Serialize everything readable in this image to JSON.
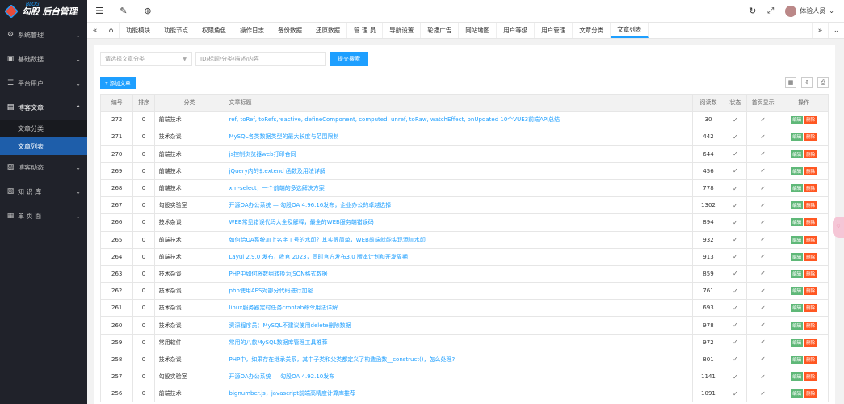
{
  "logo": {
    "brand": "勾股",
    "subtitle": "后台管理",
    "blog": "BLOG"
  },
  "sidebar": {
    "items": [
      {
        "label": "系统管理",
        "icon": "gear-icon",
        "glyph": "⚙",
        "arrow": "⌄"
      },
      {
        "label": "基础数据",
        "icon": "cube-icon",
        "glyph": "▣",
        "arrow": "⌄"
      },
      {
        "label": "平台用户",
        "icon": "users-icon",
        "glyph": "☰",
        "arrow": "⌄"
      },
      {
        "label": "博客文章",
        "icon": "file-icon",
        "glyph": "▤",
        "arrow": "⌃",
        "active": true,
        "children": [
          {
            "label": "文章分类"
          },
          {
            "label": "文章列表",
            "current": true
          }
        ]
      },
      {
        "label": "博客动态",
        "icon": "news-icon",
        "glyph": "▨",
        "arrow": "⌄"
      },
      {
        "label": "知 识 库",
        "icon": "book-icon",
        "glyph": "▧",
        "arrow": "⌄"
      },
      {
        "label": "单 页 面",
        "icon": "page-icon",
        "glyph": "▦",
        "arrow": "⌄"
      }
    ]
  },
  "topbar": {
    "user_name": "体验人员"
  },
  "tabs": [
    "功能模块",
    "功能节点",
    "权限角色",
    "操作日志",
    "备份数据",
    "还原数据",
    "管 理 员",
    "导航设置",
    "轮播广告",
    "网站地图",
    "用户等级",
    "用户管理",
    "文章分类",
    "文章列表"
  ],
  "search": {
    "category_placeholder": "请选择文章分类",
    "keyword_placeholder": "ID/标题/分类/描述/内容",
    "submit_label": "提交搜索"
  },
  "toolbar": {
    "add_label": "+ 添加文章"
  },
  "table": {
    "headers": [
      "编号",
      "排序",
      "分类",
      "文章标题",
      "阅读数",
      "状态",
      "首页显示",
      "操作"
    ],
    "edit_label": "编辑",
    "delete_label": "删除",
    "rows": [
      {
        "id": "272",
        "sort": "0",
        "cat": "前端技术",
        "title": "ref, toRef, toRefs,reactive, defineComponent, computed, unref, toRaw, watchEffect, onUpdated 10个VUE3前端API总结",
        "reads": "30"
      },
      {
        "id": "271",
        "sort": "0",
        "cat": "技术杂谈",
        "title": "MySQL各类数据类型的最大长度与范围限制",
        "reads": "442"
      },
      {
        "id": "270",
        "sort": "0",
        "cat": "前端技术",
        "title": "js控制浏览器web打印合同",
        "reads": "644"
      },
      {
        "id": "269",
        "sort": "0",
        "cat": "前端技术",
        "title": "jQuery内的$.extend 函数及用法详解",
        "reads": "456"
      },
      {
        "id": "268",
        "sort": "0",
        "cat": "前端技术",
        "title": "xm-select，一个前端的多选解决方案",
        "reads": "778"
      },
      {
        "id": "267",
        "sort": "0",
        "cat": "勾股实验室",
        "title": "开源OA办公系统 — 勾股OA 4.96.16发布，企业办公的卓越选择",
        "reads": "1302"
      },
      {
        "id": "266",
        "sort": "0",
        "cat": "技术杂谈",
        "title": "WEB常见错误代码大全及解释，最全的WEB服务端错误码",
        "reads": "894"
      },
      {
        "id": "265",
        "sort": "0",
        "cat": "前端技术",
        "title": "如何给OA系统加上名字工号的水印？其实很简单，WEB前端就能实现添加水印",
        "reads": "932"
      },
      {
        "id": "264",
        "sort": "0",
        "cat": "前端技术",
        "title": "Layui 2.9.0 发布，收官 2023，同时官方发布3.0 版本计划和开发周期",
        "reads": "913"
      },
      {
        "id": "263",
        "sort": "0",
        "cat": "技术杂谈",
        "title": "PHP中如何将数组转换为JSON格式数据",
        "reads": "859"
      },
      {
        "id": "262",
        "sort": "0",
        "cat": "技术杂谈",
        "title": "php使用AES对部分代码进行加密",
        "reads": "761"
      },
      {
        "id": "261",
        "sort": "0",
        "cat": "技术杂谈",
        "title": "linux服务器定时任务crontab命令用法详解",
        "reads": "693"
      },
      {
        "id": "260",
        "sort": "0",
        "cat": "技术杂谈",
        "title": "资深程序员：MySQL不建议使用delete删除数据",
        "reads": "978"
      },
      {
        "id": "259",
        "sort": "0",
        "cat": "常用软件",
        "title": "常用的八款MySQL数据库管理工具推荐",
        "reads": "972"
      },
      {
        "id": "258",
        "sort": "0",
        "cat": "技术杂谈",
        "title": "PHP中，如果存在继承关系，其中子类和父类都定义了构造函数__construct()，怎么处理?",
        "reads": "801"
      },
      {
        "id": "257",
        "sort": "0",
        "cat": "勾股实验室",
        "title": "开源OA办公系统 — 勾股OA 4.92.10发布",
        "reads": "1141"
      },
      {
        "id": "256",
        "sort": "0",
        "cat": "前端技术",
        "title": "bignumber.js，javascript前端高精度计算库推荐",
        "reads": "1091"
      }
    ]
  },
  "float_button": "♡"
}
